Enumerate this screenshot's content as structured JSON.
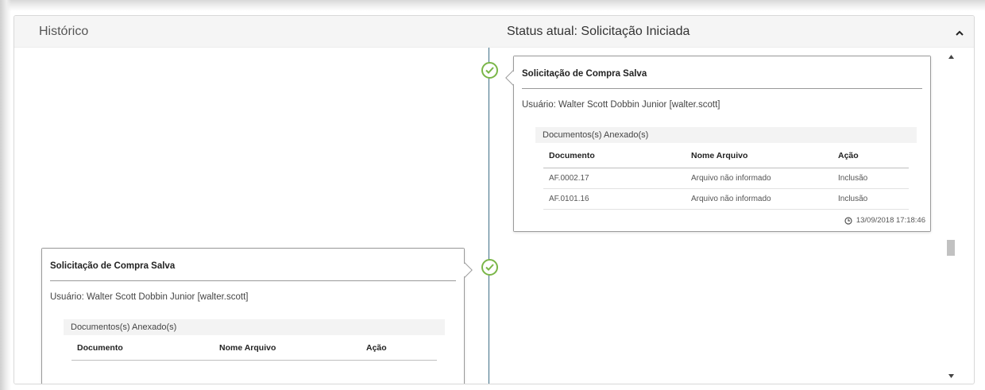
{
  "header": {
    "history_label": "Histórico",
    "status_label": "Status atual: Solicitação Iniciada"
  },
  "timeline": [
    {
      "title": "Solicitação de Compra Salva",
      "user": "Usuário: Walter Scott Dobbin Junior [walter.scott]",
      "docs_title": "Documentos(s) Anexado(s)",
      "columns": [
        "Documento",
        "Nome Arquivo",
        "Ação"
      ],
      "rows": [
        [
          "AF.0002.17",
          "Arquivo não informado",
          "Inclusão"
        ],
        [
          "AF.0101.16",
          "Arquivo não informado",
          "Inclusão"
        ]
      ],
      "timestamp": "13/09/2018 17:18:46"
    },
    {
      "title": "Solicitação de Compra Salva",
      "user": "Usuário: Walter Scott Dobbin Junior [walter.scott]",
      "docs_title": "Documentos(s) Anexado(s)",
      "columns": [
        "Documento",
        "Nome Arquivo",
        "Ação"
      ],
      "rows": []
    }
  ],
  "icons": {
    "check": "check-circle-icon",
    "clock": "clock-icon",
    "collapse": "chevron-up-icon"
  },
  "colors": {
    "accent_green": "#7ab648",
    "timeline_line": "#3f6f86"
  }
}
